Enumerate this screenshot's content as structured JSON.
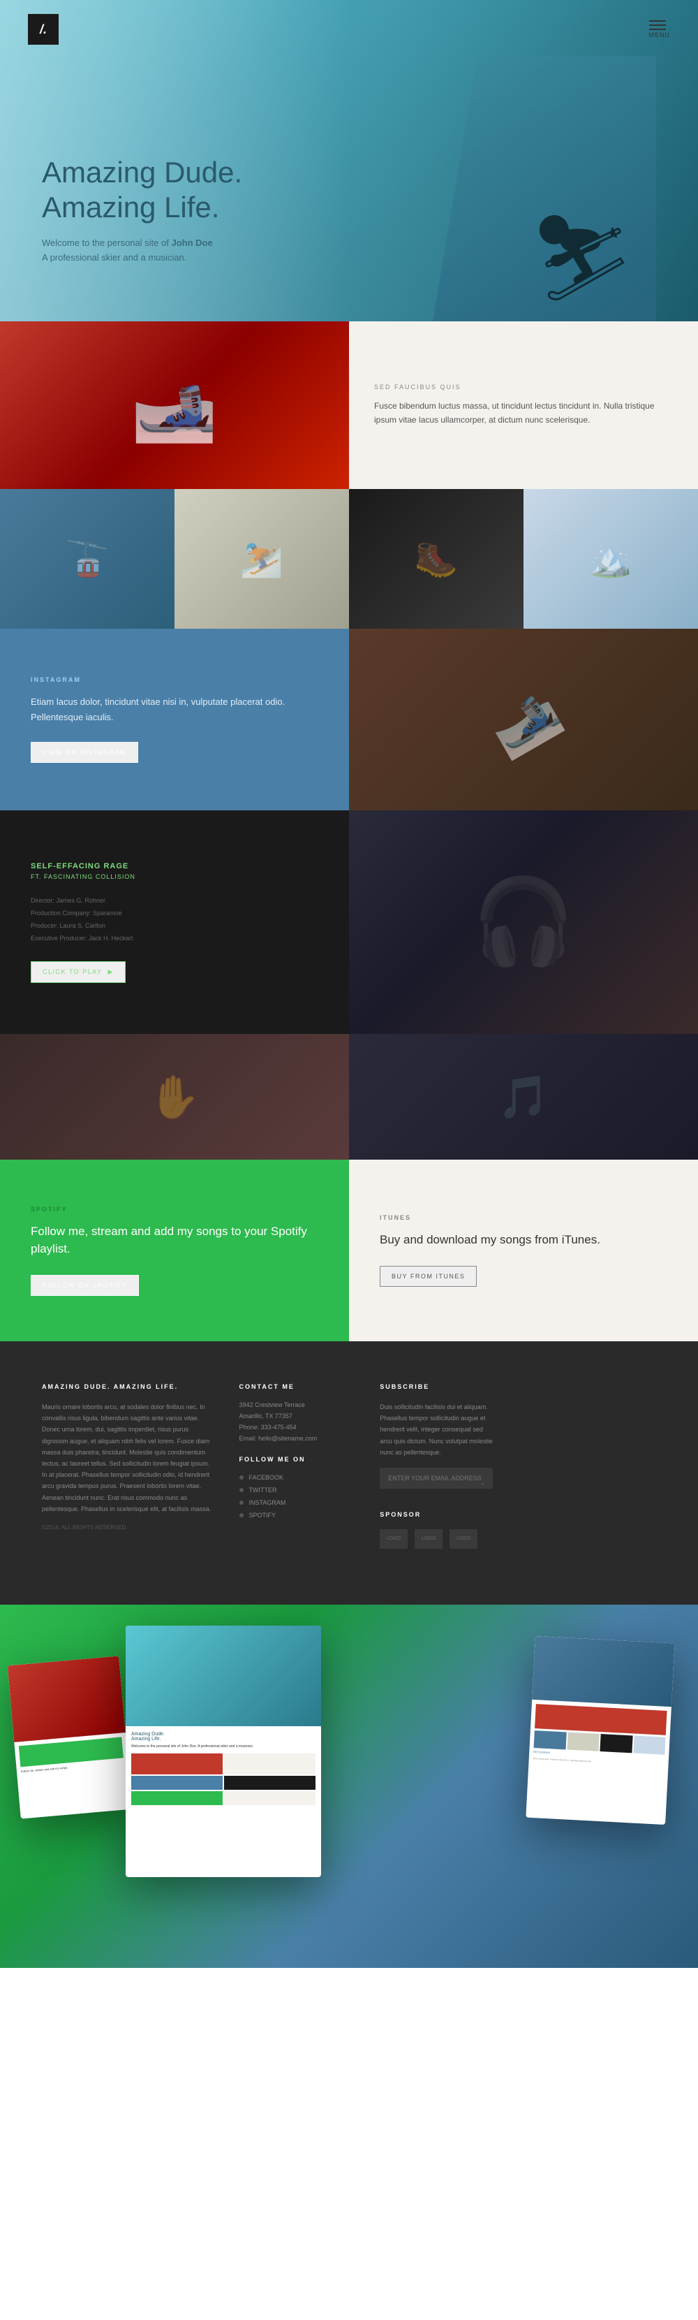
{
  "site": {
    "logo": "/.",
    "menu_label": "MENU"
  },
  "hero": {
    "title_line1": "Amazing Dude.",
    "title_line2": "Amazing Life.",
    "description": "Welcome to the personal site of",
    "name": "John Doe",
    "subtitle": "A professional skier and a musician."
  },
  "section_faucibus": {
    "label": "SED FAUCIBUS QUIS",
    "text": "Fusce bibendum luctus massa, ut tincidunt lectus tincidunt in. Nulla tristique ipsum vitae lacus ullamcorper, at dictum nunc scelerisque."
  },
  "instagram": {
    "label": "INSTAGRAM",
    "text": "Etiam lacus dolor, tincidunt vitae nisi in, vulputate placerat odio. Pellentesque iaculis.",
    "button": "VIEW ON INSTAGRAM"
  },
  "music_video": {
    "title": "SELF-EFFACING RAGE",
    "subtitle": "FT. FASCINATING COLLISION",
    "credits": [
      "Director: James G. Rohner",
      "Production Company: Sparamoe",
      "Producer: Laura S. Carlton",
      "Executive Producer: Jack H. Heckart"
    ],
    "button": "CLICK TO PLAY"
  },
  "spotify": {
    "label": "SPOTIFY",
    "text": "Follow me, stream and add my songs to your Spotify playlist.",
    "button": "FOLLOW ON SPOTIFY"
  },
  "itunes": {
    "label": "ITUNES",
    "text": "Buy and download my songs from iTunes.",
    "button": "BUY FROM ITUNES"
  },
  "footer": {
    "brand": "AMAZING DUDE. AMAZING LIFE.",
    "about_text": "Mauris ornare lobortis arcu, at sodales dolor finibus nec. In convallis risus ligula, bibendum sagittis ante varius vitae. Donec urna lorem, dui, sagittis imperdiet, risus purus dignissim augue, et aliquam nibh felis vel lorem. Fusce diam massa duis pharetra, tincidunt. Molestie quis condimentum lectus, ac laoreet tellus. Sed sollicitudin lorem feugiat ipsum. In at placerat. Phasellus tempor sollicitudin odio, id hendrerit arcu gravida tempus purus. Praesent lobortis lorem vitae. Aenean tincidunt nunc. Erat risus commodo nunc as pellentesque. Phasellus in scelerisque elit, at facilisis massa.",
    "copyright": "©2014. ALL RIGHTS RESERVED.",
    "contact": {
      "label": "CONTACT ME",
      "address_line1": "3942 Crestview Terrace",
      "address_line2": "Amarillo, TX 77357",
      "phone": "Phone: 333-475-454",
      "email": "Email: hello@sitename.com"
    },
    "follow": {
      "label": "FOLLOW ME ON",
      "items": [
        "FACEBOOK",
        "TWITTER",
        "INSTAGRAM",
        "SPOTIFY"
      ]
    },
    "subscribe": {
      "label": "SUBSCRIBE",
      "text": "Duis sollicitudin facilisis dui et aliquam. Phasellus tempor sollicitudin augue et hendrerit velit, integer consequat sed arcu quis dictum. Nunc volutpat molestie nunc as pellentesque.",
      "placeholder": "ENTER YOUR EMAIL ADDRESS"
    },
    "sponsor": {
      "label": "SPONSOR",
      "logos": [
        "LOGO",
        "LOGO",
        "LOGO"
      ]
    }
  },
  "photo_grid": {
    "cells": [
      "🚡",
      "🎿",
      "🥾",
      "🏔"
    ]
  }
}
